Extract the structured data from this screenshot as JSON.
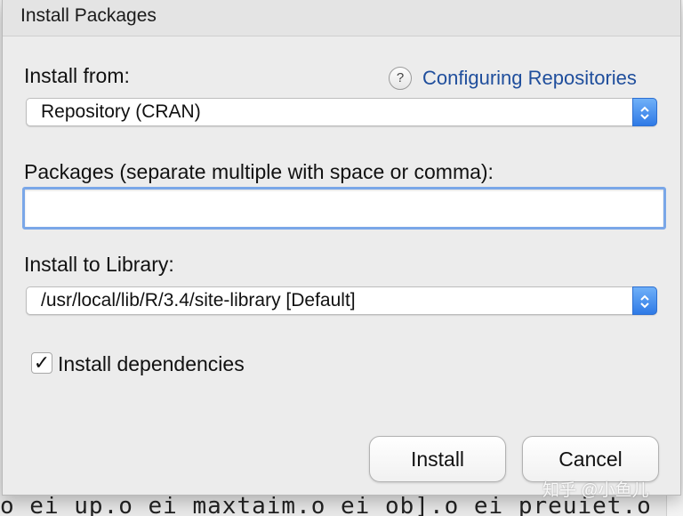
{
  "dialog": {
    "title": "Install Packages"
  },
  "install_from": {
    "label": "Install from:",
    "help_icon": "help-question-icon",
    "help_link": "Configuring Repositories",
    "selected": "Repository (CRAN)"
  },
  "packages": {
    "label": "Packages (separate multiple with space or comma):",
    "value": ""
  },
  "library": {
    "label": "Install to Library:",
    "selected": "/usr/local/lib/R/3.4/site-library [Default]"
  },
  "dependencies": {
    "label": "Install dependencies",
    "checked": true,
    "check_glyph": "✓"
  },
  "buttons": {
    "install": "Install",
    "cancel": "Cancel"
  },
  "background": {
    "code_line": "o ei_up.o ei_maxtaim.o ei_ob].o ei_preuiet.o en"
  },
  "watermark": "知乎 @小鱼儿",
  "colors": {
    "accent": "#2f7ae6",
    "link": "#1f4e9c",
    "focus_ring": "#7aa7e8"
  }
}
